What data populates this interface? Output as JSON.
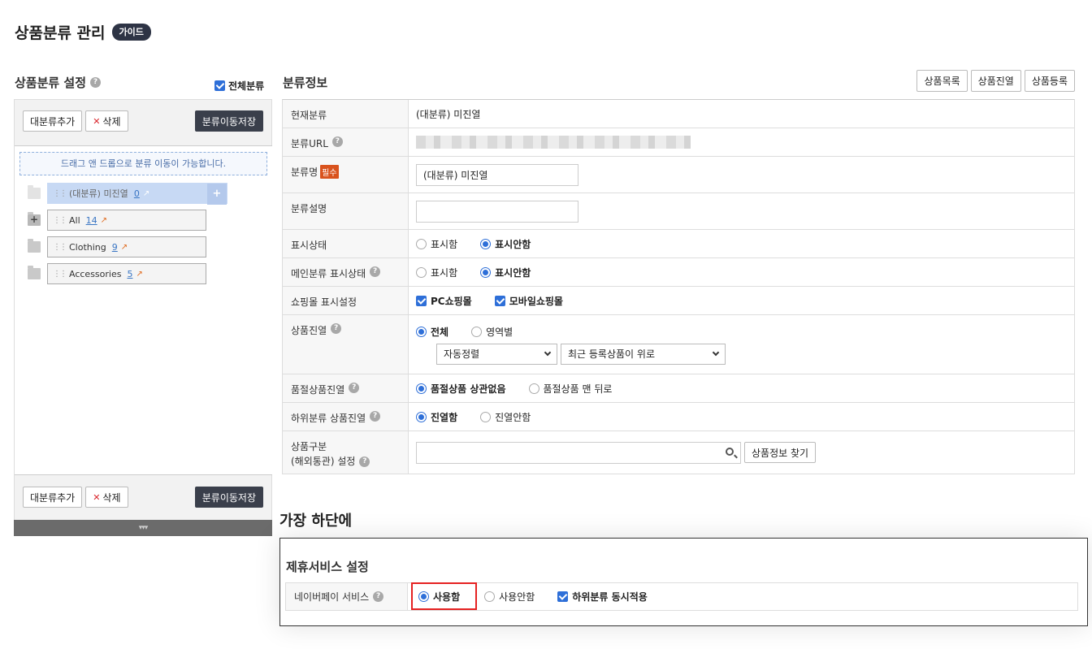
{
  "page": {
    "title": "상품분류 관리",
    "guide_badge": "가이드"
  },
  "left": {
    "section_title": "상품분류 설정",
    "all_category_label": "전체분류",
    "buttons": {
      "add_major": "대분류추가",
      "delete": "삭제",
      "save_move": "분류이동저장"
    },
    "drag_hint": "드래그 앤 드롭으로 분류 이동이 가능합니다.",
    "tree": [
      {
        "name": "(대분류) 미진열",
        "count": "0"
      },
      {
        "name": "All",
        "count": "14"
      },
      {
        "name": "Clothing",
        "count": "9"
      },
      {
        "name": "Accessories",
        "count": "5"
      }
    ]
  },
  "right": {
    "section_title": "분류정보",
    "buttons": {
      "product_list": "상품목록",
      "product_display": "상품진열",
      "product_register": "상품등록"
    },
    "rows": {
      "current": {
        "label": "현재분류",
        "value": "(대분류) 미진열"
      },
      "url": {
        "label": "분류URL"
      },
      "name": {
        "label": "분류명",
        "required": "필수",
        "value": "(대분류) 미진열"
      },
      "desc": {
        "label": "분류설명",
        "value": ""
      },
      "display": {
        "label": "표시상태",
        "opt_show": "표시함",
        "opt_hide": "표시안함"
      },
      "main_display": {
        "label": "메인분류 표시상태",
        "opt_show": "표시함",
        "opt_hide": "표시안함"
      },
      "mall_display": {
        "label": "쇼핑몰 표시설정",
        "pc": "PC쇼핑몰",
        "mobile": "모바일쇼핑몰"
      },
      "product_display": {
        "label": "상품진열",
        "opt_all": "전체",
        "opt_area": "영역별",
        "sort1": "자동정렬",
        "sort2": "최근 등록상품이 위로"
      },
      "soldout": {
        "label": "품절상품진열",
        "opt_ignore": "품절상품 상관없음",
        "opt_last": "품절상품 맨 뒤로"
      },
      "sub_display": {
        "label": "하위분류 상품진열",
        "opt_on": "진열함",
        "opt_off": "진열안함"
      },
      "customs": {
        "label_line1": "상품구분",
        "label_line2": "(해외통관) 설정",
        "value": "",
        "find_button": "상품정보 찾기"
      }
    }
  },
  "bottom": {
    "title": "가장 하단에",
    "sub_title": "제휴서비스 설정",
    "naver": {
      "label": "네이버페이 서비스",
      "opt_use": "사용함",
      "opt_nouse": "사용안함",
      "apply_sub": "하위분류 동시적용"
    }
  }
}
